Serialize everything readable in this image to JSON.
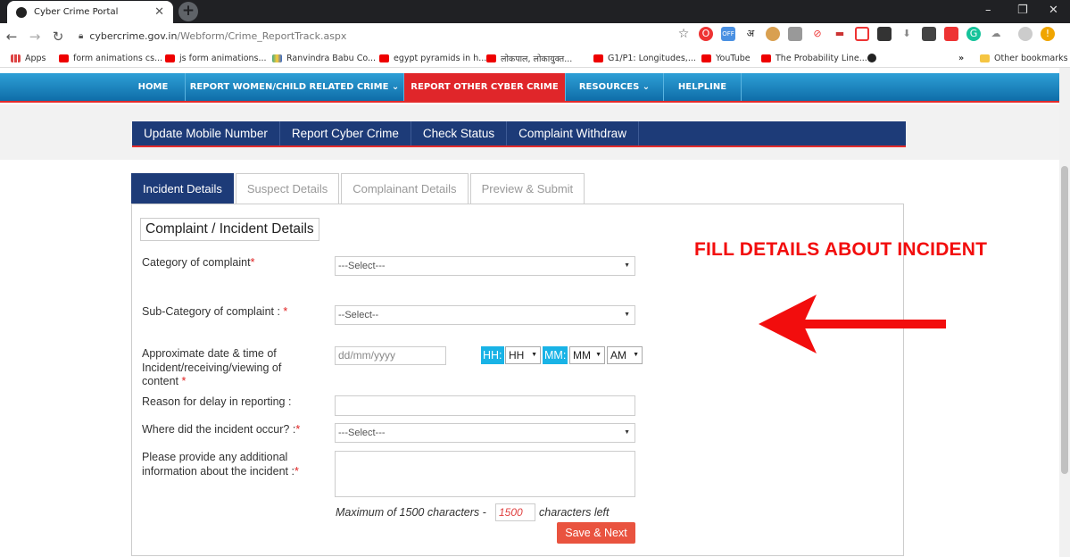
{
  "browser": {
    "tab_title": "Cyber Crime Portal",
    "tab_close": "✕",
    "new_tab": "+",
    "url_domain": "cybercrime.gov.in",
    "url_path": "/Webform/Crime_ReportTrack.aspx",
    "window_controls": [
      "–",
      "❐",
      "✕"
    ]
  },
  "bookmarks": [
    {
      "label": "Apps",
      "color": "#d44"
    },
    {
      "label": "form animations cs...",
      "color": "#e00"
    },
    {
      "label": "js form animations...",
      "color": "#e00"
    },
    {
      "label": "Ranvindra Babu Co...",
      "color": "#4a8"
    },
    {
      "label": "egypt pyramids in h...",
      "color": "#e00"
    },
    {
      "label": "लोकपाल, लोकायुक्त...",
      "color": "#e00"
    },
    {
      "label": "G1/P1: Longitudes,...",
      "color": "#e00"
    },
    {
      "label": "YouTube",
      "color": "#e00"
    },
    {
      "label": "The Probability Line...",
      "color": "#e00"
    }
  ],
  "bookmarks_overflow": "»",
  "other_bookmarks": "Other bookmarks",
  "main_nav": [
    {
      "label": "HOME",
      "active": false
    },
    {
      "label": "REPORT WOMEN/CHILD RELATED CRIME ⌄",
      "active": false
    },
    {
      "label": "REPORT OTHER CYBER CRIME",
      "active": true
    },
    {
      "label": "RESOURCES ⌄",
      "active": false
    },
    {
      "label": "HELPLINE",
      "active": false
    }
  ],
  "sub_nav": [
    "Update Mobile Number",
    "Report Cyber Crime",
    "Check Status",
    "Complaint Withdraw"
  ],
  "form_tabs": [
    {
      "label": "Incident Details",
      "active": true
    },
    {
      "label": "Suspect Details",
      "active": false
    },
    {
      "label": "Complainant Details",
      "active": false
    },
    {
      "label": "Preview & Submit",
      "active": false
    }
  ],
  "form": {
    "legend": "Complaint / Incident Details",
    "category_label": "Category of complaint",
    "category_value": "---Select---",
    "subcategory_label": "Sub-Category of complaint : ",
    "subcategory_value": "--Select--",
    "datetime_label": "Approximate date & time of Incident/receiving/viewing of content ",
    "date_placeholder": "dd/mm/yyyy",
    "hh_chip": "HH:",
    "hh_value": "HH",
    "mm_chip": "MM:",
    "mm_value": "MM",
    "ampm_value": "AM",
    "delay_label": "Reason for delay in reporting :",
    "where_label": "Where did the incident occur? :",
    "where_value": "---Select---",
    "additional_label": "Please provide any additional information about the incident :",
    "max_text": "Maximum of 1500 characters -",
    "counter_value": "1500",
    "after_text": "characters left",
    "save_button": "Save & Next",
    "required_mark": "*"
  },
  "annotation": "FILL DETAILS ABOUT INCIDENT",
  "colors": {
    "nav_blue": "#1d3b78",
    "nav_active_red": "#e0262a",
    "annotation_red": "#f20d0d",
    "save_orange": "#e9533f",
    "chip_cyan": "#19b3e6"
  }
}
